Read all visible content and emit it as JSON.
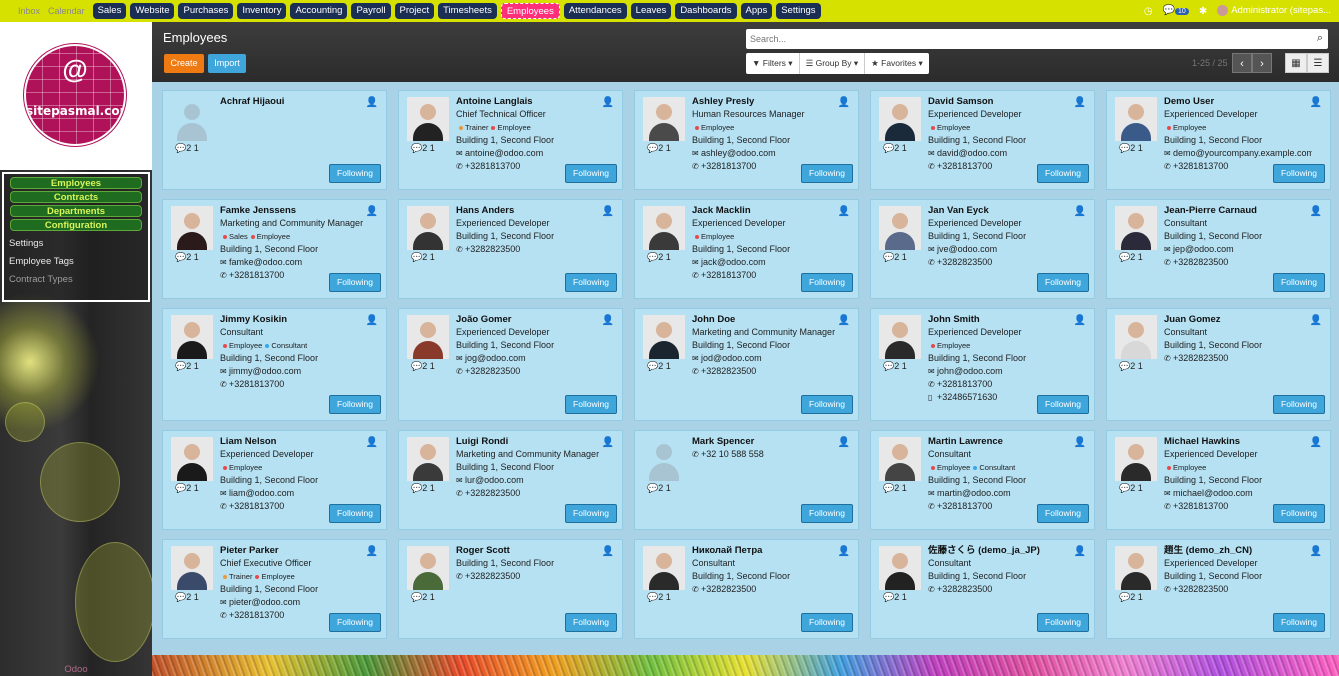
{
  "topbar": {
    "dim_items": [
      "Inbox",
      "Calendar"
    ],
    "menu": [
      "Sales",
      "Website",
      "Purchases",
      "Inventory",
      "Accounting",
      "Payroll",
      "Project",
      "Timesheets",
      "Employees",
      "Attendances",
      "Leaves",
      "Dashboards",
      "Apps",
      "Settings"
    ],
    "active": "Employees",
    "notif_count": "10",
    "user": "Administrator (sitepas..."
  },
  "sidebar": {
    "logo_text": "sitepasmal.com",
    "groups": [
      "Employees",
      "Contracts",
      "Departments",
      "Configuration"
    ],
    "items": [
      "Settings",
      "Employee Tags",
      "Contract Types"
    ],
    "footer": "Odoo"
  },
  "control": {
    "title": "Employees",
    "create_label": "Create",
    "import_label": "Import",
    "search_placeholder": "Search...",
    "filters_label": "Filters ▾",
    "groupby_label": "Group By ▾",
    "favorites_label": "Favorites ▾",
    "pager": "1-25 / 25"
  },
  "employees": [
    {
      "name": "Achraf Hijaoui",
      "job": "",
      "tags": [],
      "address": "",
      "email": "",
      "phone": "",
      "mobile": "",
      "counts": "2 1",
      "follow": "Following",
      "photo": "none"
    },
    {
      "name": "Antoine Langlais",
      "job": "Chief Technical Officer",
      "tags": [
        "Trainer",
        "Employee"
      ],
      "address": "Building 1, Second Floor",
      "email": "antoine@odoo.com",
      "phone": "+3281813700",
      "mobile": "",
      "counts": "2 1",
      "follow": "Following",
      "photo": "#222"
    },
    {
      "name": "Ashley Presly",
      "job": "Human Resources Manager",
      "tags": [
        "Employee"
      ],
      "address": "Building 1, Second Floor",
      "email": "ashley@odoo.com",
      "phone": "+3281813700",
      "mobile": "",
      "counts": "2 1",
      "follow": "Following",
      "photo": "#4a4a4a"
    },
    {
      "name": "David Samson",
      "job": "Experienced Developer",
      "tags": [
        "Employee"
      ],
      "address": "Building 1, Second Floor",
      "email": "david@odoo.com",
      "phone": "+3281813700",
      "mobile": "",
      "counts": "2 1",
      "follow": "Following",
      "photo": "#1a2a3a"
    },
    {
      "name": "Demo User",
      "job": "Experienced Developer",
      "tags": [
        "Employee"
      ],
      "address": "Building 1, Second Floor",
      "email": "demo@yourcompany.example.com",
      "phone": "+3281813700",
      "mobile": "",
      "counts": "2 1",
      "follow": "Following",
      "photo": "#3a5a8a"
    },
    {
      "name": "Famke Jenssens",
      "job": "Marketing and Community Manager",
      "tags": [
        "Sales",
        "Employee"
      ],
      "address": "Building 1, Second Floor",
      "email": "famke@odoo.com",
      "phone": "+3281813700",
      "mobile": "",
      "counts": "2 1",
      "follow": "Following",
      "photo": "#2a1a1a"
    },
    {
      "name": "Hans Anders",
      "job": "Experienced Developer",
      "tags": [],
      "address": "Building 1, Second Floor",
      "email": "",
      "phone": "+3282823500",
      "mobile": "",
      "counts": "2 1",
      "follow": "Following",
      "photo": "#333"
    },
    {
      "name": "Jack Macklin",
      "job": "Experienced Developer",
      "tags": [
        "Employee"
      ],
      "address": "Building 1, Second Floor",
      "email": "jack@odoo.com",
      "phone": "+3281813700",
      "mobile": "",
      "counts": "2 1",
      "follow": "Following",
      "photo": "#3a3a3a"
    },
    {
      "name": "Jan Van Eyck",
      "job": "Experienced Developer",
      "tags": [],
      "address": "Building 1, Second Floor",
      "email": "jve@odoo.com",
      "phone": "+3282823500",
      "mobile": "",
      "counts": "2 1",
      "follow": "Following",
      "photo": "#5a6a8a"
    },
    {
      "name": "Jean-Pierre Carnaud",
      "job": "Consultant",
      "tags": [],
      "address": "Building 1, Second Floor",
      "email": "jep@odoo.com",
      "phone": "+3282823500",
      "mobile": "",
      "counts": "2 1",
      "follow": "Following",
      "photo": "#2a2a3a"
    },
    {
      "name": "Jimmy Kosikin",
      "job": "Consultant",
      "tags": [
        "Employee",
        "Consultant"
      ],
      "address": "Building 1, Second Floor",
      "email": "jimmy@odoo.com",
      "phone": "+3281813700",
      "mobile": "",
      "counts": "2 1",
      "follow": "Following",
      "photo": "#1a1a1a"
    },
    {
      "name": "João Gomer",
      "job": "Experienced Developer",
      "tags": [],
      "address": "Building 1, Second Floor",
      "email": "jog@odoo.com",
      "phone": "+3282823500",
      "mobile": "",
      "counts": "2 1",
      "follow": "Following",
      "photo": "#8a3a2a"
    },
    {
      "name": "John Doe",
      "job": "Marketing and Community Manager",
      "tags": [],
      "address": "Building 1, Second Floor",
      "email": "jod@odoo.com",
      "phone": "+3282823500",
      "mobile": "",
      "counts": "2 1",
      "follow": "Following",
      "photo": "#1a2530"
    },
    {
      "name": "John Smith",
      "job": "Experienced Developer",
      "tags": [
        "Employee"
      ],
      "address": "Building 1, Second Floor",
      "email": "john@odoo.com",
      "phone": "+3281813700",
      "mobile": "+32486571630",
      "counts": "2 1",
      "follow": "Following",
      "photo": "#2a2a2a"
    },
    {
      "name": "Juan Gomez",
      "job": "Consultant",
      "tags": [],
      "address": "Building 1, Second Floor",
      "email": "",
      "phone": "+3282823500",
      "mobile": "",
      "counts": "2 1",
      "follow": "Following",
      "photo": "#d8d8d8"
    },
    {
      "name": "Liam Nelson",
      "job": "Experienced Developer",
      "tags": [
        "Employee"
      ],
      "address": "Building 1, Second Floor",
      "email": "liam@odoo.com",
      "phone": "+3281813700",
      "mobile": "",
      "counts": "2 1",
      "follow": "Following",
      "photo": "#1a1a1a"
    },
    {
      "name": "Luigi Rondi",
      "job": "Marketing and Community Manager",
      "tags": [],
      "address": "Building 1, Second Floor",
      "email": "lur@odoo.com",
      "phone": "+3282823500",
      "mobile": "",
      "counts": "2 1",
      "follow": "Following",
      "photo": "#3a3a3a"
    },
    {
      "name": "Mark Spencer",
      "job": "",
      "tags": [],
      "address": "",
      "email": "",
      "phone": "+32 10 588 558",
      "mobile": "",
      "counts": "2 1",
      "follow": "Following",
      "photo": "none"
    },
    {
      "name": "Martin Lawrence",
      "job": "Consultant",
      "tags": [
        "Employee",
        "Consultant"
      ],
      "address": "Building 1, Second Floor",
      "email": "martin@odoo.com",
      "phone": "+3281813700",
      "mobile": "",
      "counts": "2 1",
      "follow": "Following",
      "photo": "#444"
    },
    {
      "name": "Michael Hawkins",
      "job": "Experienced Developer",
      "tags": [
        "Employee"
      ],
      "address": "Building 1, Second Floor",
      "email": "michael@odoo.com",
      "phone": "+3281813700",
      "mobile": "",
      "counts": "2 1",
      "follow": "Following",
      "photo": "#2a2a2a"
    },
    {
      "name": "Pieter Parker",
      "job": "Chief Executive Officer",
      "tags": [
        "Trainer",
        "Employee"
      ],
      "address": "Building 1, Second Floor",
      "email": "pieter@odoo.com",
      "phone": "+3281813700",
      "mobile": "",
      "counts": "2 1",
      "follow": "Following",
      "photo": "#3a4a6a"
    },
    {
      "name": "Roger Scott",
      "job": "",
      "tags": [],
      "address": "Building 1, Second Floor",
      "email": "",
      "phone": "+3282823500",
      "mobile": "",
      "counts": "2 1",
      "follow": "Following",
      "photo": "#4a6a3a"
    },
    {
      "name": "Николай Петра",
      "job": "Consultant",
      "tags": [],
      "address": "Building 1, Second Floor",
      "email": "",
      "phone": "+3282823500",
      "mobile": "",
      "counts": "2 1",
      "follow": "Following",
      "photo": "#2a2a2a"
    },
    {
      "name": "佐藤さくら (demo_ja_JP)",
      "job": "Consultant",
      "tags": [],
      "address": "Building 1, Second Floor",
      "email": "",
      "phone": "+3282823500",
      "mobile": "",
      "counts": "2 1",
      "follow": "Following",
      "photo": "#222"
    },
    {
      "name": "趙生 (demo_zh_CN)",
      "job": "Experienced Developer",
      "tags": [],
      "address": "Building 1, Second Floor",
      "email": "",
      "phone": "+3282823500",
      "mobile": "",
      "counts": "2 1",
      "follow": "Following",
      "photo": "#2a2a2a"
    }
  ],
  "tag_colors": {
    "Trainer": "#e89a3a",
    "Employee": "#e84a4a",
    "Sales": "#e84a4a",
    "Consultant": "#3aa6e8"
  }
}
